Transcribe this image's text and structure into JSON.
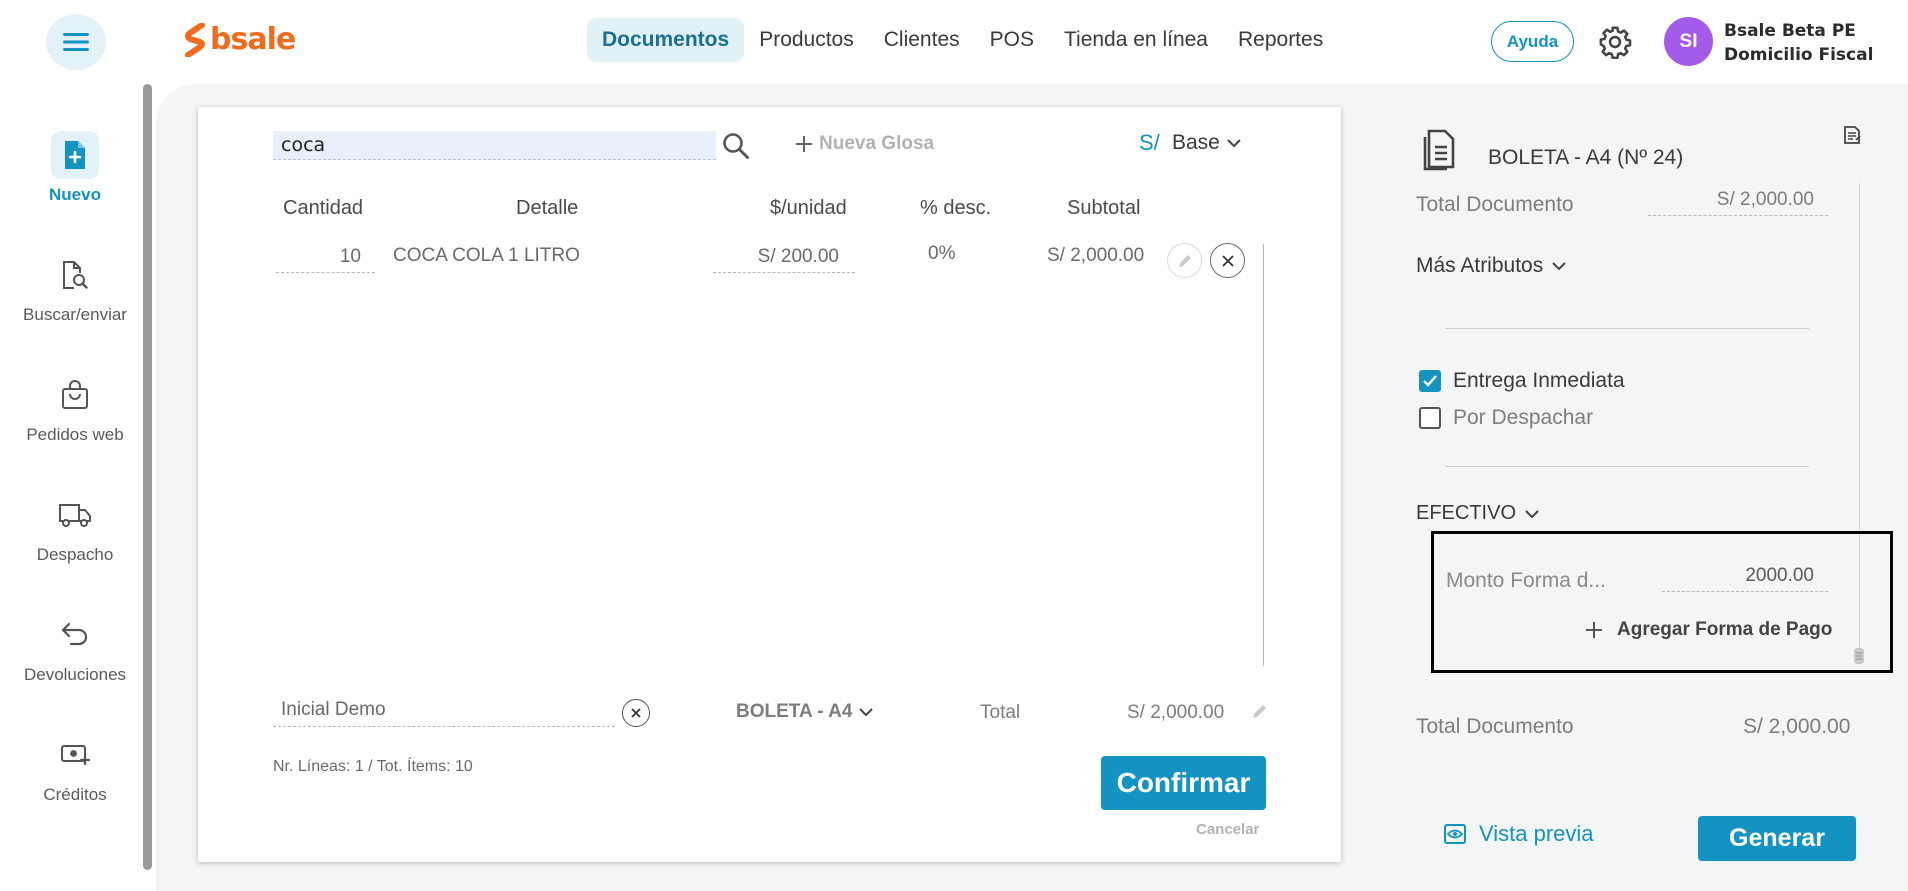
{
  "nav": {
    "logo_text": "bsale",
    "items": [
      "Documentos",
      "Productos",
      "Clientes",
      "POS",
      "Tienda en línea",
      "Reportes"
    ],
    "help_label": "Ayuda",
    "avatar_initials": "SI",
    "company_line1": "Bsale Beta PE",
    "company_line2": "Domicilio Fiscal"
  },
  "sidebar": {
    "items": [
      {
        "label": "Nuevo",
        "icon": "new-document-icon"
      },
      {
        "label": "Buscar/enviar",
        "icon": "search-document-icon"
      },
      {
        "label": "Pedidos web",
        "icon": "shopping-bag-icon"
      },
      {
        "label": "Despacho",
        "icon": "truck-icon"
      },
      {
        "label": "Devoluciones",
        "icon": "return-arrow-icon"
      },
      {
        "label": "Créditos",
        "icon": "money-icon"
      }
    ]
  },
  "editor": {
    "search_value": "coca",
    "new_glosa_label": "Nueva Glosa",
    "currency_symbol": "S/",
    "price_list": "Base",
    "columns": [
      "Cantidad",
      "Detalle",
      "$/unidad",
      "% desc.",
      "Subtotal"
    ],
    "rows": [
      {
        "qty": "10",
        "detail": "COCA COLA 1 LITRO",
        "unit_price": "S/ 200.00",
        "discount": "0%",
        "subtotal": "S/ 2,000.00"
      }
    ],
    "client": "Inicial Demo",
    "doc_type": "BOLETA - A4",
    "total_label": "Total",
    "total_value": "S/ 2,000.00",
    "summary": "Nr. Líneas: 1 / Tot. Ítems: 10",
    "confirm_label": "Confirmar",
    "cancel_label": "Cancelar"
  },
  "panel": {
    "doc_title": "BOLETA - A4 (Nº 24)",
    "total_doc_label": "Total Documento",
    "total_doc_value": "S/ 2,000.00",
    "more_attributes": "Más Atributos",
    "delivery_immediate": "Entrega Inmediata",
    "delivery_pending": "Por Despachar",
    "payment_method": "EFECTIVO",
    "payment_amount_label": "Monto Forma d...",
    "payment_amount_value": "2000.00",
    "add_payment": "Agregar Forma de Pago",
    "total_doc_label_2": "Total Documento",
    "total_doc_value_2": "S/ 2,000.00",
    "preview_label": "Vista previa",
    "generate_label": "Generar"
  },
  "colors": {
    "accent": "#1293c1",
    "brand": "#f26a1b",
    "avatar": "#a55bea"
  }
}
